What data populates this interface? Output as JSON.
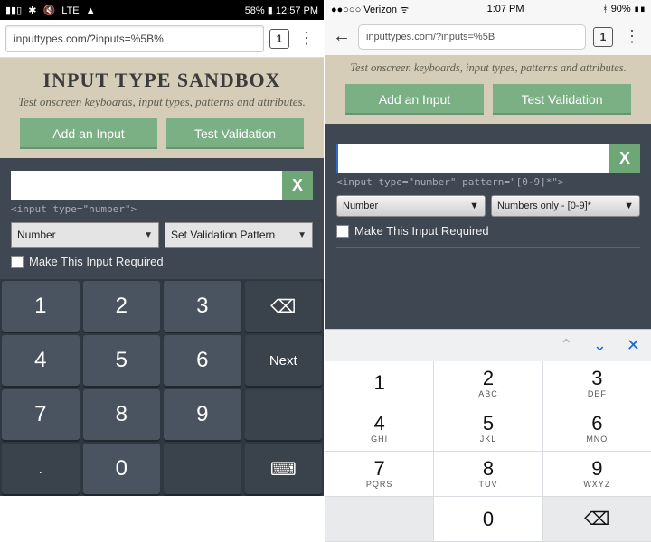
{
  "android": {
    "status": {
      "lte": "LTE",
      "battery": "58%",
      "time": "12:57 PM"
    },
    "url": "inputtypes.com/?inputs=%5B%",
    "tabs": "1",
    "page": {
      "title": "INPUT TYPE SANDBOX",
      "subtitle": "Test onscreen keyboards, input types,\npatterns and attributes.",
      "add_btn": "Add an Input",
      "test_btn": "Test Validation"
    },
    "form": {
      "clear": "X",
      "code": "<input type=\"number\">",
      "sel_type": "Number",
      "sel_pattern": "Set Validation Pattern",
      "required": "Make This Input Required"
    },
    "keys": {
      "r1": [
        "1",
        "2",
        "3"
      ],
      "r1_bk": "⌫",
      "r2": [
        "4",
        "5",
        "6"
      ],
      "r2_next": "Next",
      "r3": [
        "7",
        "8",
        "9"
      ],
      "r4": [
        ".",
        "0",
        " "
      ],
      "r4_kb": "⌨"
    }
  },
  "ios": {
    "status": {
      "carrier": "Verizon",
      "time": "1:07 PM",
      "battery_pct": "90%"
    },
    "url": "inputtypes.com/?inputs=%5B",
    "tabs": "1",
    "page": {
      "subtitle": "Test onscreen keyboards, input types,\npatterns and attributes.",
      "add_btn": "Add an Input",
      "test_btn": "Test Validation"
    },
    "form": {
      "clear": "X",
      "code": "<input type=\"number\" pattern=\"[0-9]*\">",
      "sel_type": "Number",
      "sel_pattern": "Numbers only - [0-9]*",
      "required": "Make This Input Required"
    },
    "keypad": {
      "rows": [
        [
          {
            "n": "1",
            "l": ""
          },
          {
            "n": "2",
            "l": "ABC"
          },
          {
            "n": "3",
            "l": "DEF"
          }
        ],
        [
          {
            "n": "4",
            "l": "GHI"
          },
          {
            "n": "5",
            "l": "JKL"
          },
          {
            "n": "6",
            "l": "MNO"
          }
        ],
        [
          {
            "n": "7",
            "l": "PQRS"
          },
          {
            "n": "8",
            "l": "TUV"
          },
          {
            "n": "9",
            "l": "WXYZ"
          }
        ]
      ],
      "zero": "0",
      "backspace": "⌫",
      "close": "✕"
    }
  }
}
